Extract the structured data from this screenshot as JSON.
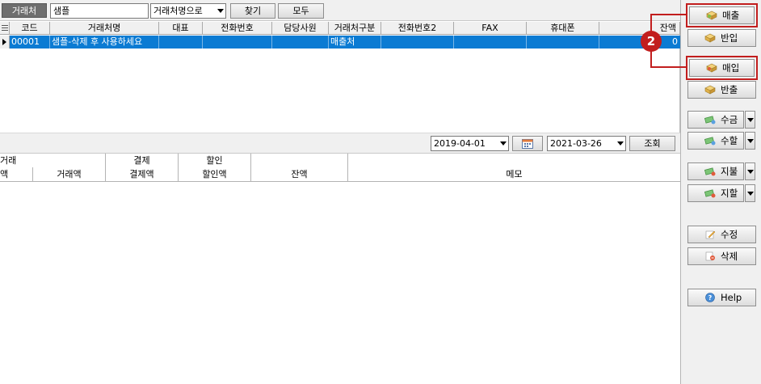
{
  "search": {
    "label": "거래처",
    "value": "샘플",
    "field_select": "거래처명으로",
    "find_button": "찾기",
    "all_button": "모두"
  },
  "grid1": {
    "columns": [
      "코드",
      "거래처명",
      "대표",
      "전화번호",
      "담당사원",
      "거래처구분",
      "전화번호2",
      "FAX",
      "휴대폰",
      "잔액"
    ],
    "rows": [
      {
        "code": "00001",
        "name": "샘플-삭제 후 사용하세요",
        "rep": "",
        "phone": "",
        "staff": "",
        "type": "매출처",
        "phone2": "",
        "fax": "",
        "mobile": "",
        "balance": "0"
      }
    ]
  },
  "period": {
    "from": "2019-04-01",
    "to": "2021-03-26",
    "query_button": "조회"
  },
  "grid2": {
    "group_headers": [
      "거래",
      "결제",
      "할인"
    ],
    "columns": [
      "액",
      "거래액",
      "결제액",
      "할인액",
      "잔액",
      "메모"
    ]
  },
  "side_buttons": {
    "sale": "매출",
    "return_in": "반입",
    "purchase": "매입",
    "return_out": "반출",
    "receipt": "수금",
    "receipt_disc": "수할",
    "payment": "지불",
    "payment_disc": "지할",
    "edit": "수정",
    "delete": "삭제",
    "help": "Help"
  },
  "callout": {
    "number": "2"
  },
  "colors": {
    "selection": "#0b7bd3",
    "highlight": "#c21e1e"
  }
}
